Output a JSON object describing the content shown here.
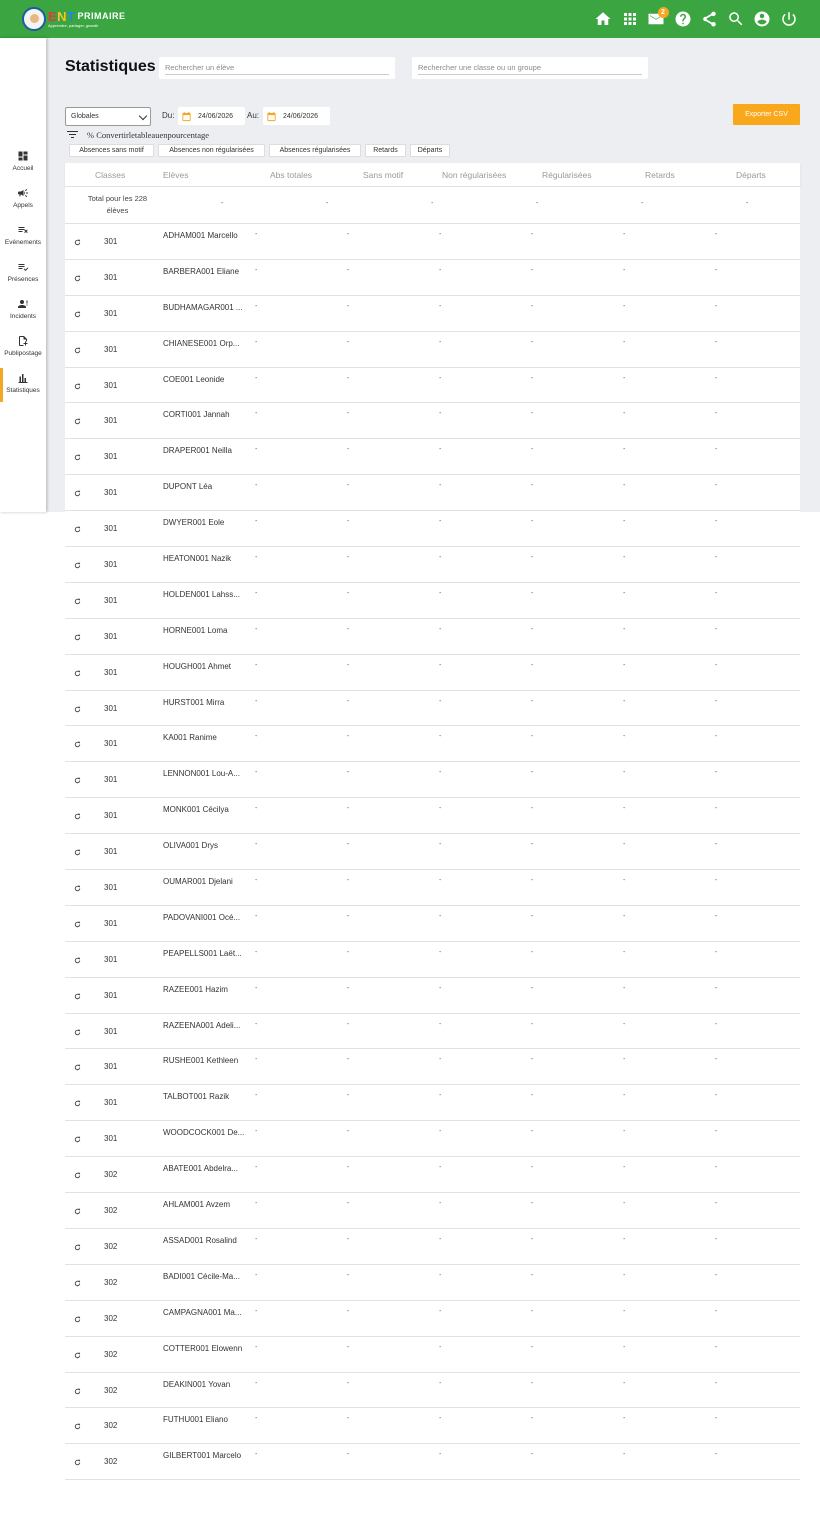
{
  "header": {
    "logo_text_e": "E",
    "logo_text_n": "N",
    "logo_text_t": "T",
    "logo_text_primaire": "PRIMAIRE",
    "logo_tagline": "Apprendre, partager, grandir",
    "mail_badge": "2",
    "icons": [
      "home-icon",
      "apps-icon",
      "mail-icon",
      "help-icon",
      "share-icon",
      "search-icon",
      "account-icon",
      "power-icon"
    ]
  },
  "sidebar": {
    "items": [
      {
        "label": "Accueil",
        "icon": "dashboard-icon"
      },
      {
        "label": "Appels",
        "icon": "megaphone-icon"
      },
      {
        "label": "Evénements",
        "icon": "events-icon"
      },
      {
        "label": "Présences",
        "icon": "presences-icon"
      },
      {
        "label": "Incidents",
        "icon": "incidents-icon"
      },
      {
        "label": "Publipostage",
        "icon": "mailing-icon"
      },
      {
        "label": "Statistiques",
        "icon": "stats-icon",
        "active": true
      }
    ]
  },
  "page": {
    "title": "Statistiques",
    "search_student_placeholder": "Rechercher un élève",
    "search_class_placeholder": "Rechercher une classe ou un groupe",
    "mode_select": "Globales",
    "from_label": "Du:",
    "from_date": "24/06/2026",
    "to_label": "Au:",
    "to_date": "24/06/2026",
    "export_label": "Exporter CSV",
    "convert_label": "% Convertirletableauenpourcentage",
    "filters": [
      "Absences sans motif",
      "Absences non régularisées",
      "Absences régularisées",
      "Retards",
      "Départs"
    ]
  },
  "table": {
    "columns": [
      "Classes",
      "Elèves",
      "Abs totales",
      "Sans motif",
      "Non régularisées",
      "Régularisées",
      "Retards",
      "Départs"
    ],
    "total_label": "Total pour les 228 élèves",
    "empty": "-",
    "rows": [
      {
        "class": "301",
        "name": "ADHAM001 Marcello"
      },
      {
        "class": "301",
        "name": "BARBERA001 Eliane"
      },
      {
        "class": "301",
        "name": "BUDHAMAGAR001 ..."
      },
      {
        "class": "301",
        "name": "CHIANESE001 Orp..."
      },
      {
        "class": "301",
        "name": "COE001 Leonide"
      },
      {
        "class": "301",
        "name": "CORTI001 Jannah"
      },
      {
        "class": "301",
        "name": "DRAPER001 Neilla"
      },
      {
        "class": "301",
        "name": "DUPONT Léa"
      },
      {
        "class": "301",
        "name": "DWYER001 Eole"
      },
      {
        "class": "301",
        "name": "HEATON001 Nazik"
      },
      {
        "class": "301",
        "name": "HOLDEN001 Lahss..."
      },
      {
        "class": "301",
        "name": "HORNE001 Loma"
      },
      {
        "class": "301",
        "name": "HOUGH001 Ahmet"
      },
      {
        "class": "301",
        "name": "HURST001 Mirra"
      },
      {
        "class": "301",
        "name": "KA001 Ranime"
      },
      {
        "class": "301",
        "name": "LENNON001 Lou-A..."
      },
      {
        "class": "301",
        "name": "MONK001 Cécilya"
      },
      {
        "class": "301",
        "name": "OLIVA001 Drys"
      },
      {
        "class": "301",
        "name": "OUMAR001 Djelani"
      },
      {
        "class": "301",
        "name": "PADOVANI001 Océ..."
      },
      {
        "class": "301",
        "name": "PEAPELLS001 Laët..."
      },
      {
        "class": "301",
        "name": "RAZEE001 Hazim"
      },
      {
        "class": "301",
        "name": "RAZEENA001 Adeli..."
      },
      {
        "class": "301",
        "name": "RUSHE001 Kethleen"
      },
      {
        "class": "301",
        "name": "TALBOT001 Razik"
      },
      {
        "class": "301",
        "name": "WOODCOCK001 De..."
      },
      {
        "class": "302",
        "name": "ABATE001 Abdelra..."
      },
      {
        "class": "302",
        "name": "AHLAM001 Avzem"
      },
      {
        "class": "302",
        "name": "ASSAD001 Rosalind"
      },
      {
        "class": "302",
        "name": "BADI001 Cécile-Ma..."
      },
      {
        "class": "302",
        "name": "CAMPAGNA001 Ma..."
      },
      {
        "class": "302",
        "name": "COTTER001 Elowenn"
      },
      {
        "class": "302",
        "name": "DEAKIN001 Yovan"
      },
      {
        "class": "302",
        "name": "FUTHU001 Eliano"
      },
      {
        "class": "302",
        "name": "GILBERT001 Marcelo"
      }
    ]
  }
}
